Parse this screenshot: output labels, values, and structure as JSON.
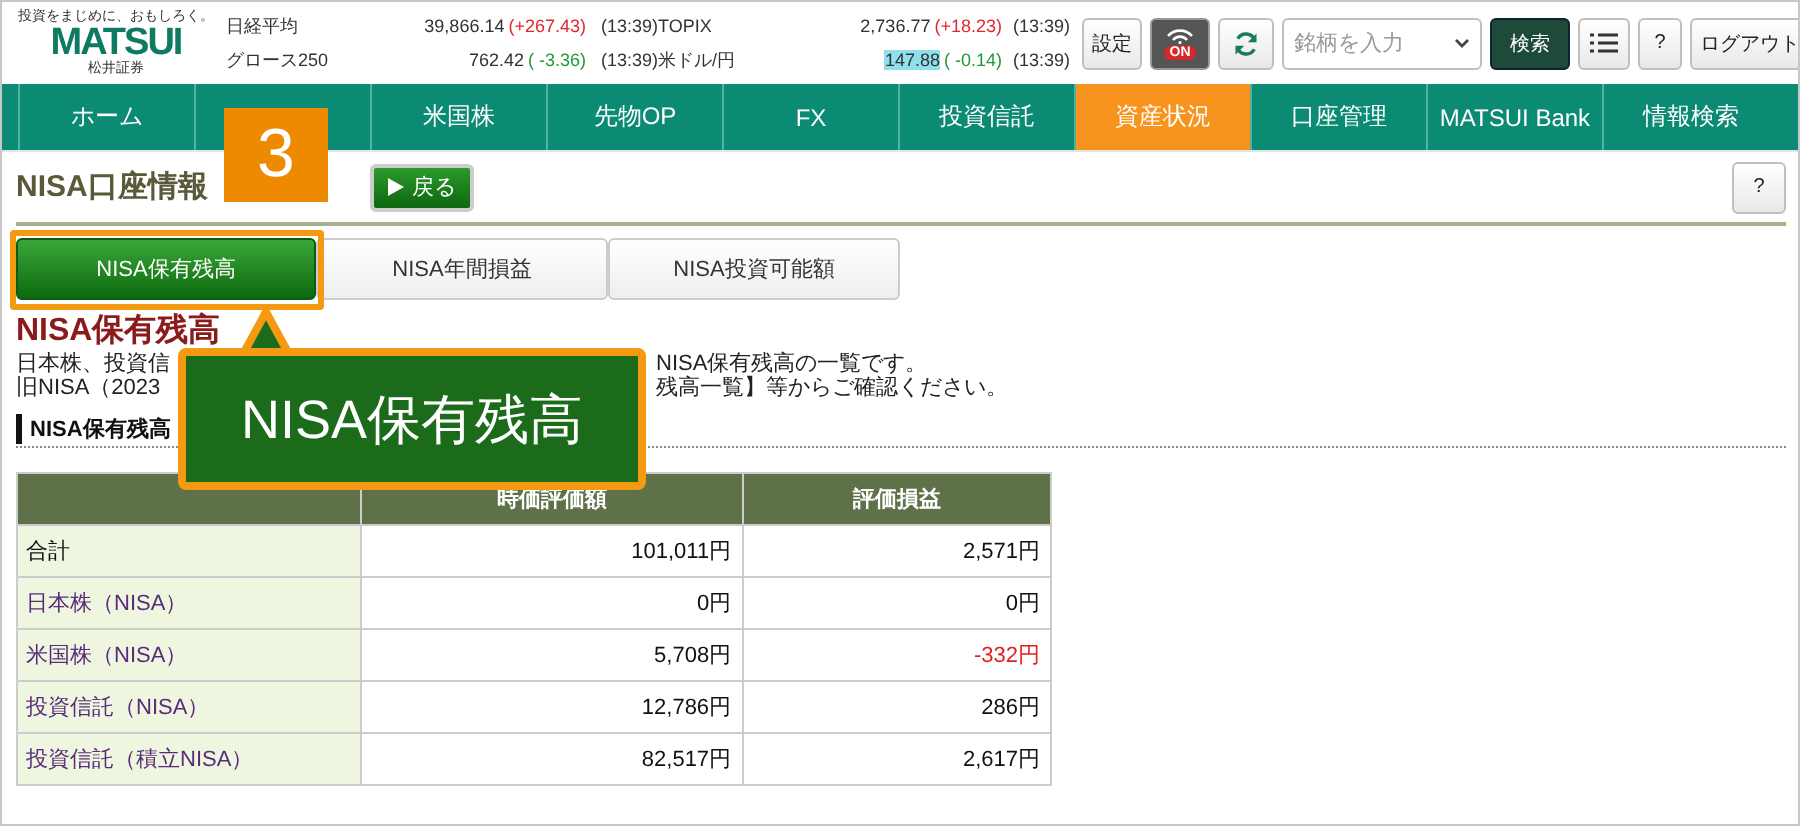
{
  "logo": {
    "tagline": "投資をまじめに、おもしろく。",
    "name": "MATSUI",
    "sub": "松井証券"
  },
  "market": [
    {
      "name": "日経平均",
      "value": "39,866.14",
      "change": "(+267.43)",
      "color": "#e0282e",
      "time": "(13:39)",
      "highlighted": false
    },
    {
      "name": "TOPIX",
      "value": "2,736.77",
      "change": "(+18.23)",
      "color": "#e0282e",
      "time": "(13:39)",
      "highlighted": false
    },
    {
      "name": "グロース250",
      "value": "762.42",
      "change": "( -3.36)",
      "color": "#1f9a3a",
      "time": "(13:39)",
      "highlighted": false
    },
    {
      "name": "米ドル/円",
      "value": "147.88",
      "change": "( -0.14)",
      "color": "#1f9a3a",
      "time": "(13:39)",
      "highlighted": true
    }
  ],
  "toolbar": {
    "settings": "設定",
    "alert_label": "ON",
    "alert_on": true,
    "search_placeholder": "銘柄を入力",
    "search_button": "検索",
    "help": "?",
    "logout": "ログアウト"
  },
  "nav": [
    {
      "label": "ホーム",
      "selected": false
    },
    {
      "selected": false
    },
    {
      "label": "米国株",
      "selected": false
    },
    {
      "label": "先物OP",
      "selected": false
    },
    {
      "label": "FX",
      "selected": false
    },
    {
      "label": "投資信託",
      "selected": false
    },
    {
      "label": "資産状況",
      "selected": true
    },
    {
      "label": "口座管理",
      "selected": false
    },
    {
      "label": "MATSUI Bank",
      "selected": false
    },
    {
      "label": "情報検索",
      "selected": false
    }
  ],
  "page": {
    "title": "NISA口座情報",
    "back": "戻る",
    "help": "?"
  },
  "tabs": [
    {
      "label": "NISA保有残高",
      "selected": true
    },
    {
      "label": "NISA年間損益",
      "selected": false
    },
    {
      "label": "NISA投資可能額",
      "selected": false
    }
  ],
  "heading": "NISA保有残高",
  "description": [
    [
      "日本株、投資信",
      "NISA保有残高の一覧です。"
    ],
    [
      "旧NISA（2023",
      "残高一覧】等からご確認ください。"
    ]
  ],
  "section": "NISA保有残高",
  "table": {
    "columns": [
      "時価評価額",
      "評価損益"
    ],
    "rows": [
      {
        "label": "合計",
        "kind": "total",
        "values": [
          {
            "text": "101,011円",
            "negative": false
          },
          {
            "text": "2,571円",
            "negative": false
          }
        ]
      },
      {
        "label": "日本株（NISA）",
        "kind": "item",
        "values": [
          {
            "text": "0円",
            "negative": false
          },
          {
            "text": "0円",
            "negative": false
          }
        ]
      },
      {
        "label": "米国株（NISA）",
        "kind": "item",
        "values": [
          {
            "text": "5,708円",
            "negative": false
          },
          {
            "text": "-332円",
            "negative": true
          }
        ]
      },
      {
        "label": "投資信託（NISA）",
        "kind": "item",
        "values": [
          {
            "text": "12,786円",
            "negative": false
          },
          {
            "text": "286円",
            "negative": false
          }
        ]
      },
      {
        "label": "投資信託（積立NISA）",
        "kind": "item",
        "values": [
          {
            "text": "82,517円",
            "negative": false
          },
          {
            "text": "2,617円",
            "negative": false
          }
        ]
      }
    ]
  },
  "annotation": {
    "step": "3",
    "callout": "NISA保有残高"
  }
}
